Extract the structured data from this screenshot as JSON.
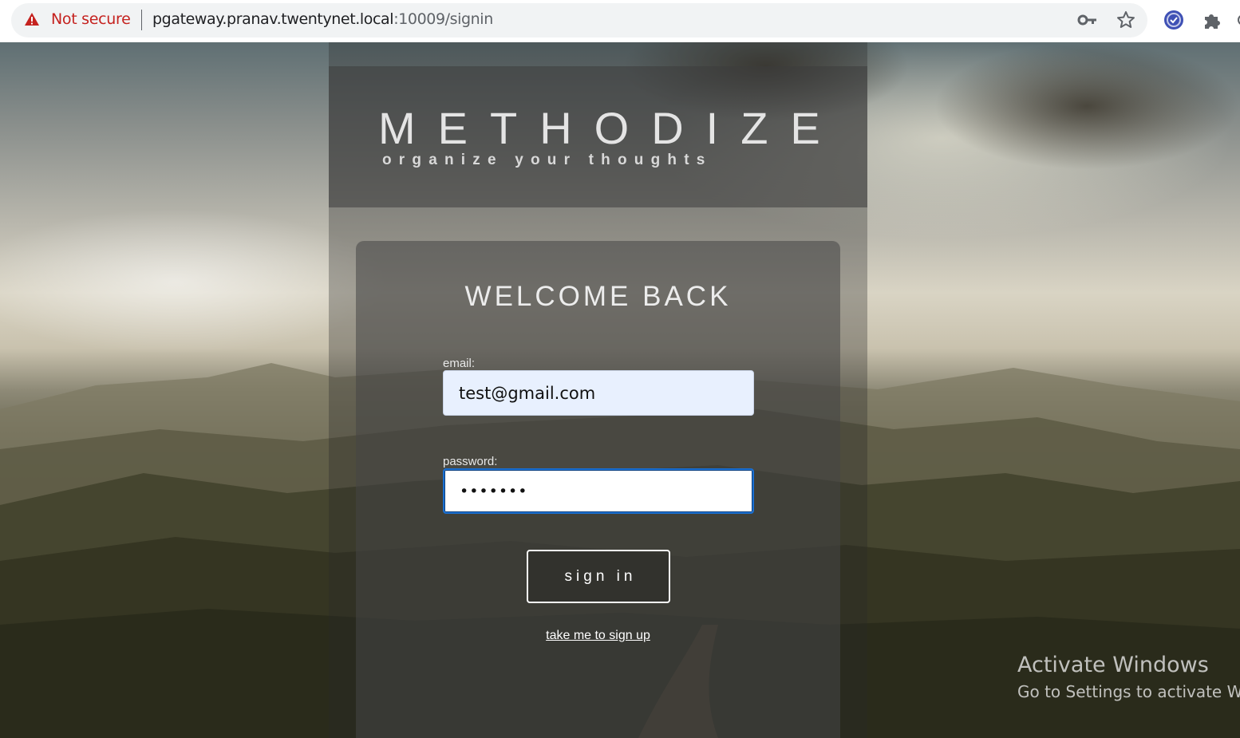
{
  "browser": {
    "security_label": "Not secure",
    "url_host": "pgateway.pranav.twentynet.local",
    "url_rest": ":10009/signin",
    "icons": [
      "warning-icon",
      "key-icon",
      "star-icon",
      "extension-badge-icon",
      "puzzle-icon"
    ]
  },
  "app": {
    "brand": "METHODIZE",
    "tagline": "organize your thoughts"
  },
  "signin_form": {
    "heading": "WELCOME BACK",
    "email_label": "email:",
    "email_value": "test@gmail.com",
    "password_label": "password:",
    "password_value": "•••••••",
    "submit_label": "sign in",
    "signup_link": "take me to sign up"
  },
  "os_watermark": {
    "title": "Activate Windows",
    "subtitle": "Go to Settings to activate Wi"
  },
  "colors": {
    "not_secure": "#c5221f",
    "focus_border": "#1a6fd1",
    "autofill_bg": "#e8f0fe"
  }
}
